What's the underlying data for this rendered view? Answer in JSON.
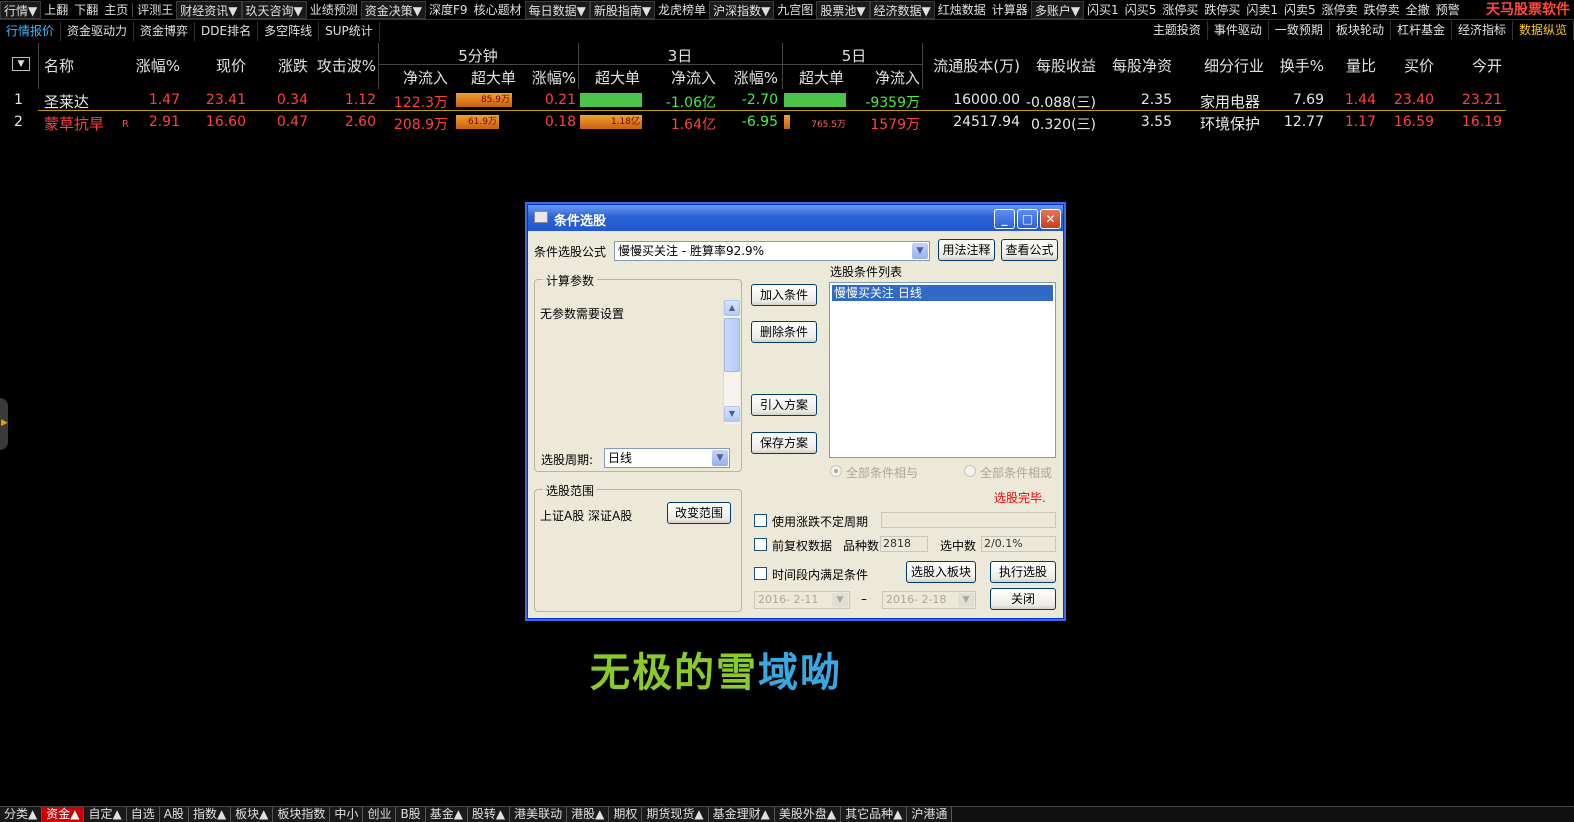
{
  "menubar": {
    "items": [
      "行情▼",
      "上翻",
      "下翻",
      "主页",
      "评测王",
      "财经资讯▼",
      "玖天咨询▼",
      "业绩预测",
      "资金决策▼",
      "深度F9",
      "核心题材",
      "每日数据▼",
      "新股指南▼",
      "龙虎榜单",
      "沪深指数▼",
      "九宫图",
      "股票池▼",
      "经济数据▼",
      "红烛数据",
      "计算器",
      "多账户▼",
      "闪买1",
      "闪买5",
      "涨停买",
      "跌停买",
      "闪卖1",
      "闪卖5",
      "涨停卖",
      "跌停卖",
      "全撤",
      "预警"
    ],
    "brand": "天马股票软件"
  },
  "subtabs": {
    "left": [
      "行情报价",
      "资金驱动力",
      "资金博弈",
      "DDE排名",
      "多空阵线",
      "SUP统计"
    ],
    "right": [
      "主题投资",
      "事件驱动",
      "一致预期",
      "板块轮动",
      "杠杆基金",
      "经济指标",
      "数据纵览"
    ]
  },
  "table": {
    "sort_icon": "▼",
    "headers": {
      "name": "名称",
      "pct": "涨幅%",
      "price": "现价",
      "chg": "涨跌",
      "attack": "攻击波%",
      "g5": "5分钟",
      "g3": "3日",
      "g5d": "5日",
      "net": "净流入",
      "big": "超大单",
      "pct2": "涨幅%",
      "float_shares": "流通股本(万)",
      "eps": "每股收益",
      "bvps": "每股净资",
      "industry": "细分行业",
      "turnover": "换手%",
      "vol_ratio": "量比",
      "bid": "买价",
      "open": "今开"
    },
    "rows": [
      {
        "no": "1",
        "name": "圣莱达",
        "flag": "",
        "pct": "1.47",
        "price": "23.41",
        "chg": "0.34",
        "attack": "1.12",
        "m5_net": "122.3万",
        "m5_big": "85.9万",
        "m5_pct": "0.21",
        "d3_big": "",
        "d3_net": "-1.06亿",
        "d3_pct": "-2.70",
        "d5_big": "",
        "d5_net": "-9359万",
        "float": "16000.00",
        "eps": "-0.088(三)",
        "bvps": "2.35",
        "industry": "家用电器",
        "turnover": "7.69",
        "vol_ratio": "1.44",
        "bid": "23.40",
        "open": "23.21",
        "m5_big_fill": 0.9,
        "d3_big_fill": 1.0,
        "d5_big_fill": 1.0
      },
      {
        "no": "2",
        "name": "蒙草抗旱",
        "flag": "R",
        "pct": "2.91",
        "price": "16.60",
        "chg": "0.47",
        "attack": "2.60",
        "m5_net": "208.9万",
        "m5_big": "61.9万",
        "m5_pct": "0.18",
        "d3_big": "1.18亿",
        "d3_net": "1.64亿",
        "d3_pct": "-6.95",
        "d5_big": "765.5万",
        "d5_net": "1579万",
        "float": "24517.94",
        "eps": "0.320(三)",
        "bvps": "3.55",
        "industry": "环境保护",
        "turnover": "12.77",
        "vol_ratio": "1.17",
        "bid": "16.59",
        "open": "16.19",
        "m5_big_fill": 0.7,
        "d3_big_fill": 1.0,
        "d5_big_fill": 0.1
      }
    ]
  },
  "dialog": {
    "title": "条件选股",
    "formula_label": "条件选股公式",
    "formula_value": "慢慢买关注   - 胜算率92.9%",
    "btn_usage": "用法注释",
    "btn_view": "查看公式",
    "params_group": "计算参数",
    "params_text": "无参数需要设置",
    "period_label": "选股周期:",
    "period_value": "日线",
    "btn_add": "加入条件",
    "btn_delete": "删除条件",
    "btn_import": "引入方案",
    "btn_save": "保存方案",
    "list_title": "选股条件列表",
    "list_item": "慢慢买关注   日线",
    "radio_and": "全部条件相与",
    "radio_or": "全部条件相或",
    "status": "选股完毕.",
    "range_group": "选股范围",
    "range_text": "上证A股 深证A股",
    "btn_range": "改变范围",
    "chk_period": "使用涨跌不定周期",
    "chk_adjust": "前复权数据",
    "count_label": "品种数",
    "count_value": "2818",
    "selected_label": "选中数",
    "selected_value": "2/0.1%",
    "chk_timerange": "时间段内满足条件",
    "btn_to_block": "选股入板块",
    "btn_execute": "执行选股",
    "date_from": "2016- 2-11",
    "date_dash": "–",
    "date_to": "2016- 2-18",
    "btn_close": "关闭"
  },
  "watermark": {
    "part1": "无极的雪",
    "part2": "域呦"
  },
  "bottombar": {
    "tabs": [
      "分类▲",
      "资金▲",
      "自定▲",
      "自选",
      "A股",
      "指数▲",
      "板块▲",
      "板块指数",
      "中小",
      "创业",
      "B股",
      "基金▲",
      "股转▲",
      "港美联动",
      "港股▲",
      "期权",
      "期货现货▲",
      "基金理财▲",
      "美股外盘▲",
      "其它品种▲",
      "沪港通"
    ],
    "active_index": 1
  },
  "colors": {
    "up": "#ff4040",
    "down": "#44ee44",
    "accent_tab": "#3fb4ff",
    "dialog_title": "#2f62d8"
  }
}
